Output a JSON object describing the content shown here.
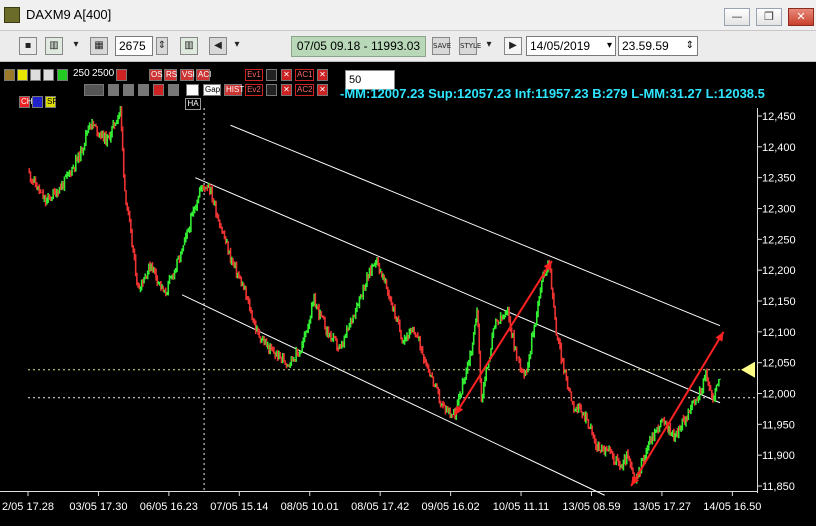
{
  "window": {
    "title": "DAXM9 A[400]",
    "minimize_symbol": "—",
    "maximize_symbol": "❐",
    "close_symbol": "✕"
  },
  "toolbar": {
    "bars_value": "2675",
    "range_text": "07/05 09.18 - 11993.03",
    "date_value": "14/05/2019",
    "time_value": "23.59.59",
    "save_label": "SAVE",
    "style_label": "STYLE"
  },
  "indicator_bar": {
    "vol_labels": [
      "250",
      "2500"
    ],
    "row1_buttons": [
      "OS",
      "RS",
      "VSI",
      "ACI",
      "Ev1",
      "AC1",
      "AC1"
    ],
    "row2_buttons": [
      "Gap",
      "HIST",
      "Ev2",
      "AC2",
      "AC2"
    ],
    "row3_buttons": [
      "CH",
      "SP"
    ],
    "quantity_value": "50",
    "ha_label": "HA"
  },
  "stats_text": "-MM:12007.23 Sup:12057.23 Inf:11957.23 B:279 L-MM:31.27 L:12038.5",
  "colors": {
    "up_candle": "#33ee33",
    "down_candle": "#ee3333",
    "channel_line": "#ffffff",
    "trend_arrow": "#ff2222",
    "axis_text": "#ffffff",
    "stats_text": "#2fe6ff",
    "price_marker": "#ffff88"
  },
  "chart_data": {
    "type": "candlestick",
    "y_ticks": [
      "12,450",
      "12,400",
      "12,350",
      "12,300",
      "12,250",
      "12,200",
      "12,150",
      "12,100",
      "12,050",
      "12,000",
      "11,950",
      "11,900",
      "11,850"
    ],
    "x_ticks": [
      "2/05 17.28",
      "03/05 17.30",
      "06/05 16.23",
      "07/05 15.14",
      "08/05 10.01",
      "08/05 17.42",
      "09/05 16.02",
      "10/05 11.11",
      "13/05 08.59",
      "13/05 17.27",
      "14/05 16.50"
    ],
    "ylim": [
      11835,
      12470
    ],
    "last_price": 12038.5,
    "horizontal_levels": [
      12038.5,
      11993.03
    ],
    "price_path": [
      [
        0.0,
        12360
      ],
      [
        2.0,
        12310
      ],
      [
        4.0,
        12340
      ],
      [
        6.0,
        12390
      ],
      [
        7.0,
        12440
      ],
      [
        9.0,
        12410
      ],
      [
        10.5,
        12460
      ],
      [
        11.0,
        12330
      ],
      [
        12.5,
        12170
      ],
      [
        14.0,
        12210
      ],
      [
        15.5,
        12160
      ],
      [
        17.5,
        12230
      ],
      [
        19.5,
        12330
      ],
      [
        20.5,
        12340
      ],
      [
        21.5,
        12290
      ],
      [
        23.0,
        12220
      ],
      [
        24.5,
        12170
      ],
      [
        26.0,
        12100
      ],
      [
        27.5,
        12070
      ],
      [
        29.5,
        12050
      ],
      [
        31.0,
        12070
      ],
      [
        32.5,
        12150
      ],
      [
        34.0,
        12100
      ],
      [
        35.5,
        12070
      ],
      [
        37.5,
        12150
      ],
      [
        39.5,
        12220
      ],
      [
        41.0,
        12160
      ],
      [
        42.5,
        12090
      ],
      [
        44.0,
        12100
      ],
      [
        45.5,
        12040
      ],
      [
        47.0,
        11980
      ],
      [
        48.5,
        11965
      ],
      [
        50.5,
        12080
      ],
      [
        51.0,
        12140
      ],
      [
        51.5,
        11990
      ],
      [
        53.0,
        12110
      ],
      [
        54.5,
        12130
      ],
      [
        55.5,
        12060
      ],
      [
        56.5,
        12030
      ],
      [
        57.5,
        12110
      ],
      [
        58.5,
        12190
      ],
      [
        59.2,
        12215
      ],
      [
        60.0,
        12100
      ],
      [
        61.0,
        12030
      ],
      [
        62.0,
        11980
      ],
      [
        63.5,
        11960
      ],
      [
        64.5,
        11915
      ],
      [
        66.0,
        11905
      ],
      [
        67.5,
        11880
      ],
      [
        68.0,
        11900
      ],
      [
        69.0,
        11855
      ],
      [
        70.5,
        11920
      ],
      [
        72.0,
        11955
      ],
      [
        73.5,
        11930
      ],
      [
        75.0,
        11970
      ],
      [
        76.0,
        11990
      ],
      [
        77.0,
        12030
      ],
      [
        77.8,
        11990
      ],
      [
        78.6,
        12030
      ]
    ],
    "channels": [
      {
        "x0": 17.5,
        "y0": 12160,
        "x1": 65.5,
        "y1": 11835
      },
      {
        "x0": 19.0,
        "y0": 12350,
        "x1": 78.6,
        "y1": 11985
      },
      {
        "x0": 23.0,
        "y0": 12435,
        "x1": 78.6,
        "y1": 12110
      }
    ],
    "arrows": [
      {
        "from": [
          48.5,
          11965
        ],
        "to": [
          59.5,
          12215
        ]
      },
      {
        "from": [
          68.5,
          11850
        ],
        "to": [
          79.0,
          12100
        ]
      }
    ],
    "vline_x": 20.0
  }
}
